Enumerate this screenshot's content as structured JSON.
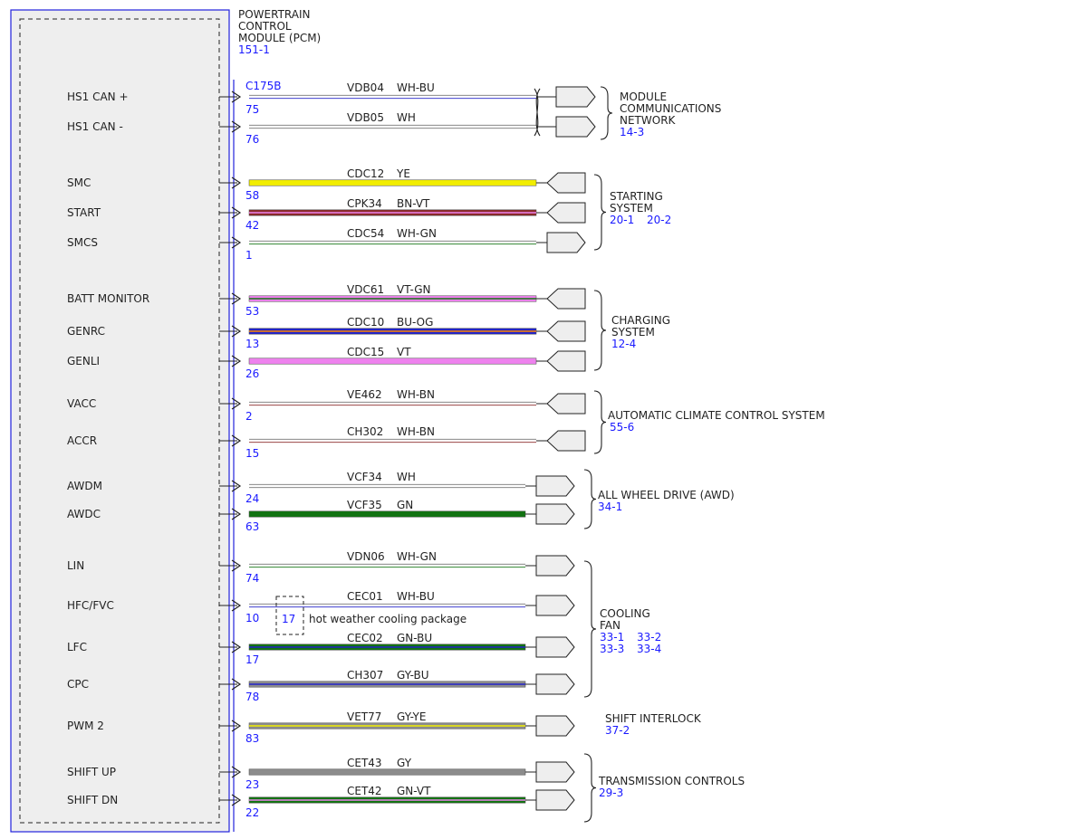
{
  "module": {
    "title_lines": [
      "POWERTRAIN",
      "CONTROL",
      "MODULE (PCM)"
    ],
    "ref": "151-1",
    "connector": "C175B"
  },
  "colors": {
    "frame": "#2222dd",
    "module_fill": "#eeeeee",
    "ref_text": "#1a1aff",
    "YE": "#f2ee00",
    "BN": "#8b2a2a",
    "VT": "#ee82ee",
    "BU": "#2323c8",
    "GN": "#127312",
    "GY": "#8c8c8c",
    "WH": "#bbbbbb",
    "OG": "#ff8800"
  },
  "wires": [
    {
      "signal": "HS1 CAN +",
      "pin": "75",
      "circuit": "VDB04",
      "color": "WH-BU"
    },
    {
      "signal": "HS1 CAN -",
      "pin": "76",
      "circuit": "VDB05",
      "color": "WH"
    },
    {
      "signal": "SMC",
      "pin": "58",
      "circuit": "CDC12",
      "color": "YE"
    },
    {
      "signal": "START",
      "pin": "42",
      "circuit": "CPK34",
      "color": "BN-VT"
    },
    {
      "signal": "SMCS",
      "pin": "1",
      "circuit": "CDC54",
      "color": "WH-GN"
    },
    {
      "signal": "BATT MONITOR",
      "pin": "53",
      "circuit": "VDC61",
      "color": "VT-GN"
    },
    {
      "signal": "GENRC",
      "pin": "13",
      "circuit": "CDC10",
      "color": "BU-OG"
    },
    {
      "signal": "GENLI",
      "pin": "26",
      "circuit": "CDC15",
      "color": "VT"
    },
    {
      "signal": "VACC",
      "pin": "2",
      "circuit": "VE462",
      "color": "WH-BN"
    },
    {
      "signal": "ACCR",
      "pin": "15",
      "circuit": "CH302",
      "color": "WH-BN"
    },
    {
      "signal": "AWDM",
      "pin": "24",
      "circuit": "VCF34",
      "color": "WH"
    },
    {
      "signal": "AWDC",
      "pin": "63",
      "circuit": "VCF35",
      "color": "GN"
    },
    {
      "signal": "LIN",
      "pin": "74",
      "circuit": "VDN06",
      "color": "WH-GN"
    },
    {
      "signal": "HFC/FVC",
      "pin": "10",
      "circuit": "CEC01",
      "color": "WH-BU"
    },
    {
      "signal": "LFC",
      "pin": "17",
      "circuit": "CEC02",
      "color": "GN-BU"
    },
    {
      "signal": "CPC",
      "pin": "78",
      "circuit": "CH307",
      "color": "GY-BU"
    },
    {
      "signal": "PWM 2",
      "pin": "83",
      "circuit": "VET77",
      "color": "GY-YE"
    },
    {
      "signal": "SHIFT UP",
      "pin": "23",
      "circuit": "CET43",
      "color": "GY"
    },
    {
      "signal": "SHIFT DN",
      "pin": "22",
      "circuit": "CET42",
      "color": "GN-VT"
    }
  ],
  "option": {
    "pin": "17",
    "note": "hot weather cooling package"
  },
  "systems": [
    {
      "name_lines": [
        "MODULE",
        "COMMUNICATIONS",
        "NETWORK"
      ],
      "refs": [
        "14-3"
      ]
    },
    {
      "name_lines": [
        "STARTING",
        "SYSTEM"
      ],
      "refs": [
        "20-1",
        "20-2"
      ]
    },
    {
      "name_lines": [
        "CHARGING",
        "SYSTEM"
      ],
      "refs": [
        "12-4"
      ]
    },
    {
      "name_lines": [
        "AUTOMATIC CLIMATE CONTROL SYSTEM"
      ],
      "refs": [
        "55-6"
      ]
    },
    {
      "name_lines": [
        "ALL WHEEL DRIVE (AWD)"
      ],
      "refs": [
        "34-1"
      ]
    },
    {
      "name_lines": [
        "COOLING",
        "FAN"
      ],
      "refs": [
        "33-1",
        "33-2",
        "33-3",
        "33-4"
      ]
    },
    {
      "name_lines": [
        "SHIFT INTERLOCK"
      ],
      "refs": [
        "37-2"
      ]
    },
    {
      "name_lines": [
        "TRANSMISSION CONTROLS"
      ],
      "refs": [
        "29-3"
      ]
    }
  ]
}
